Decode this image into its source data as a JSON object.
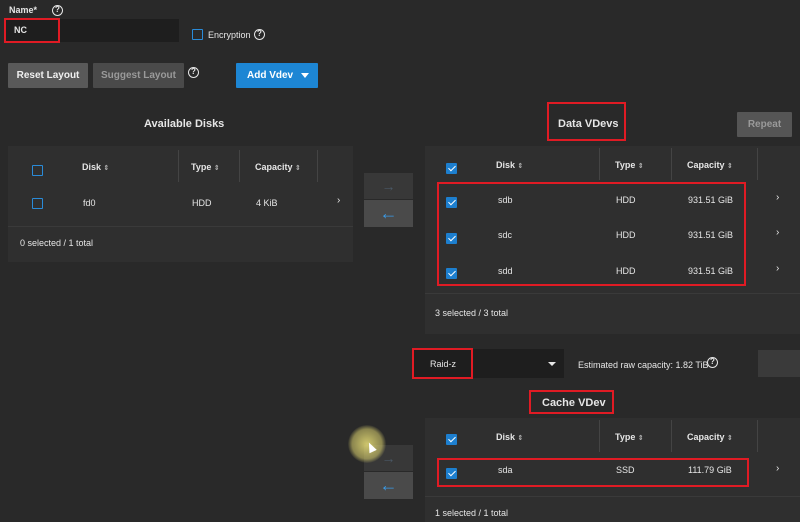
{
  "form": {
    "name_label": "Name*",
    "name_value": "NC",
    "encryption_label": "Encryption"
  },
  "buttons": {
    "reset_layout": "Reset Layout",
    "suggest_layout": "Suggest Layout",
    "add_vdev": "Add Vdev",
    "repeat": "Repeat"
  },
  "available": {
    "title": "Available Disks",
    "columns": [
      "Disk",
      "Type",
      "Capacity"
    ],
    "rows": [
      {
        "disk": "fd0",
        "type": "HDD",
        "capacity": "4 KiB"
      }
    ],
    "footer": "0 selected / 1 total"
  },
  "data_vdevs": {
    "title": "Data VDevs",
    "columns": [
      "Disk",
      "Type",
      "Capacity"
    ],
    "rows": [
      {
        "disk": "sdb",
        "type": "HDD",
        "capacity": "931.51 GiB"
      },
      {
        "disk": "sdc",
        "type": "HDD",
        "capacity": "931.51 GiB"
      },
      {
        "disk": "sdd",
        "type": "HDD",
        "capacity": "931.51 GiB"
      }
    ],
    "footer": "3 selected / 3 total",
    "layout_value": "Raid-z",
    "estimated_capacity": "Estimated raw capacity: 1.82 TiB"
  },
  "cache_vdev": {
    "title": "Cache VDev",
    "columns": [
      "Disk",
      "Type",
      "Capacity"
    ],
    "rows": [
      {
        "disk": "sda",
        "type": "SSD",
        "capacity": "111.79 GiB"
      }
    ],
    "footer": "1 selected / 1 total"
  },
  "colors": {
    "accent": "#1d7fcf",
    "highlight": "#e01b24",
    "background": "#292929"
  }
}
